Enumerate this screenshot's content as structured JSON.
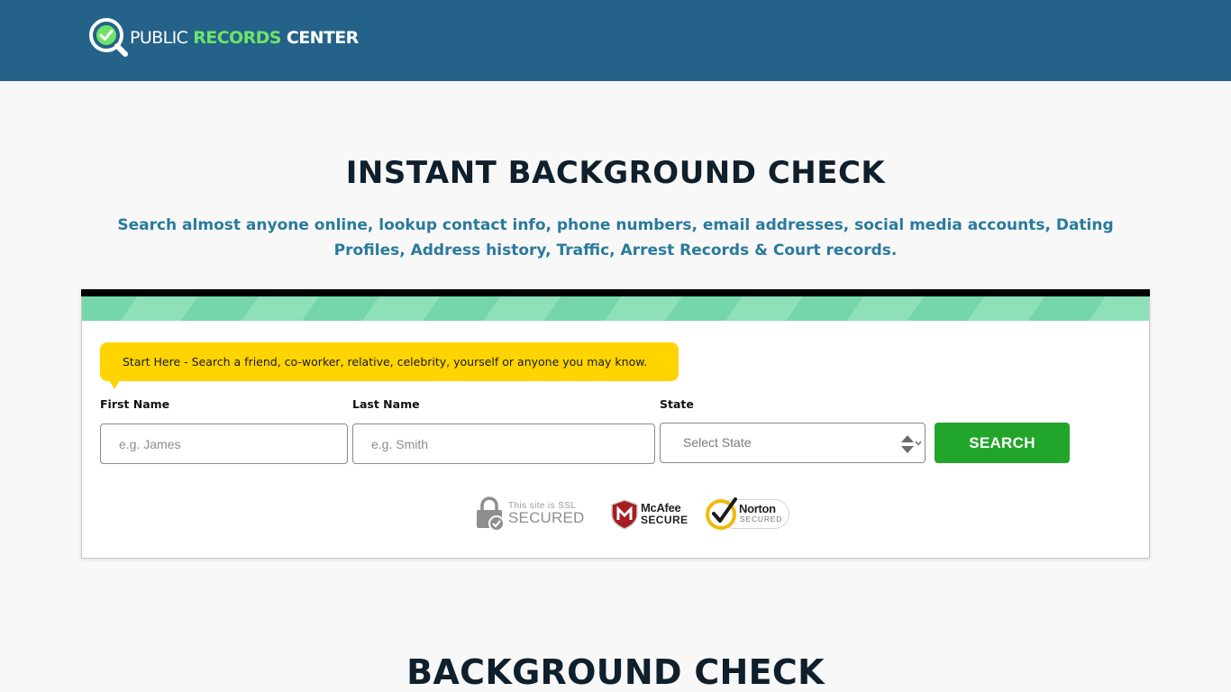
{
  "header": {
    "logo": {
      "word1": "PUBLIC",
      "word2": "RECORDS",
      "word3": "CENTER"
    }
  },
  "hero": {
    "title": "INSTANT BACKGROUND CHECK",
    "subtitle": "Search almost anyone online, lookup contact info, phone numbers, email addresses, social media accounts, Dating Profiles, Address history, Traffic, Arrest Records & Court records."
  },
  "form": {
    "callout": "Start Here - Search a friend, co-worker, relative, celebrity, yourself or anyone you may know.",
    "first_name": {
      "label": "First Name",
      "placeholder": "e.g. James",
      "value": ""
    },
    "last_name": {
      "label": "Last Name",
      "placeholder": "e.g. Smith",
      "value": ""
    },
    "state": {
      "label": "State",
      "selected": "Select State"
    },
    "search_label": "SEARCH"
  },
  "trust_badges": {
    "ssl": {
      "small": "This site is SSL",
      "big": "SECURED"
    },
    "mcafee": {
      "name": "McAfee",
      "secure": "SECURE"
    },
    "norton": {
      "name": "Norton",
      "sub": "SECURED"
    }
  },
  "section": {
    "title": "BACKGROUND CHECK"
  },
  "colors": {
    "header_bg": "#246289",
    "brand_green": "#6ee36a",
    "button_green": "#22a52b",
    "callout_yellow": "#ffd400",
    "subtitle_blue": "#2a7a9c"
  },
  "icons": [
    "magnifier-check-icon",
    "padlock-check-icon",
    "mcafee-shield-icon",
    "norton-check-icon",
    "select-arrows-icon"
  ]
}
